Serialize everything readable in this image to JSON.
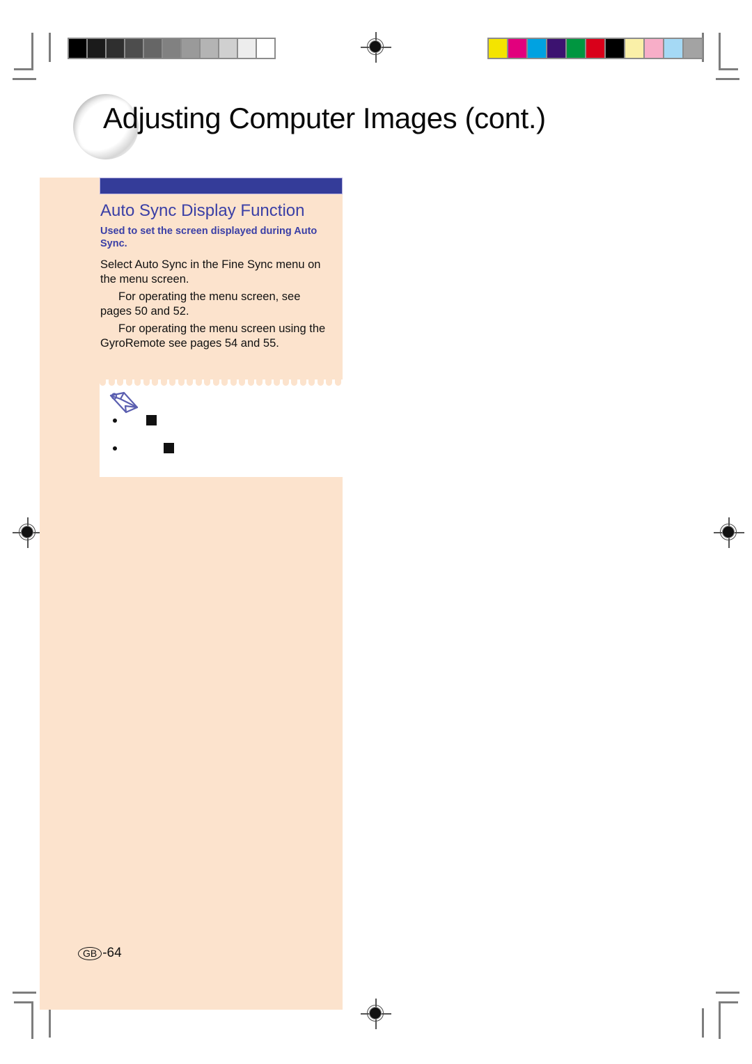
{
  "document": {
    "page_title": "Adjusting Computer Images (cont.)",
    "page_number": "-64",
    "page_region_code": "GB"
  },
  "section": {
    "heading": "Auto Sync Display Function",
    "subtitle": "Used to set the screen displayed during Auto Sync.",
    "paragraphs": [
      "Select  Auto Sync  in the  Fine Sync  menu on the menu screen.",
      "For operating the menu screen, see pages 50 and 52.",
      "For operating the menu screen using the GyroRemote see pages 54 and 55."
    ]
  },
  "note": {
    "icon": "pencil-icon",
    "items": [
      {
        "marker": "square",
        "text": ""
      },
      {
        "marker": "square",
        "text": ""
      }
    ]
  },
  "calibration": {
    "gray_strip_label": "grayscale-calibration-strip",
    "gray_patches": [
      "#000000",
      "#1b1b1b",
      "#2f2f2f",
      "#4d4d4d",
      "#666666",
      "#818181",
      "#9a9a9a",
      "#b4b4b4",
      "#d0d0d0",
      "#ededed",
      "#ffffff"
    ],
    "color_strip_label": "color-calibration-strip",
    "color_patches": [
      "#f4e400",
      "#e2007d",
      "#00a2e1",
      "#3c1270",
      "#009640",
      "#d9001a",
      "#000000",
      "#faf0a8",
      "#f7aec8",
      "#a5d9f5",
      "#a3a3a3"
    ]
  },
  "theme": {
    "page_background": "#ffffff",
    "content_background": "#fce3cd",
    "accent_bar": "#343c99",
    "heading_color": "#3a3fa6",
    "body_color": "#111111",
    "crop_mark_color": "#7d7d7d"
  }
}
